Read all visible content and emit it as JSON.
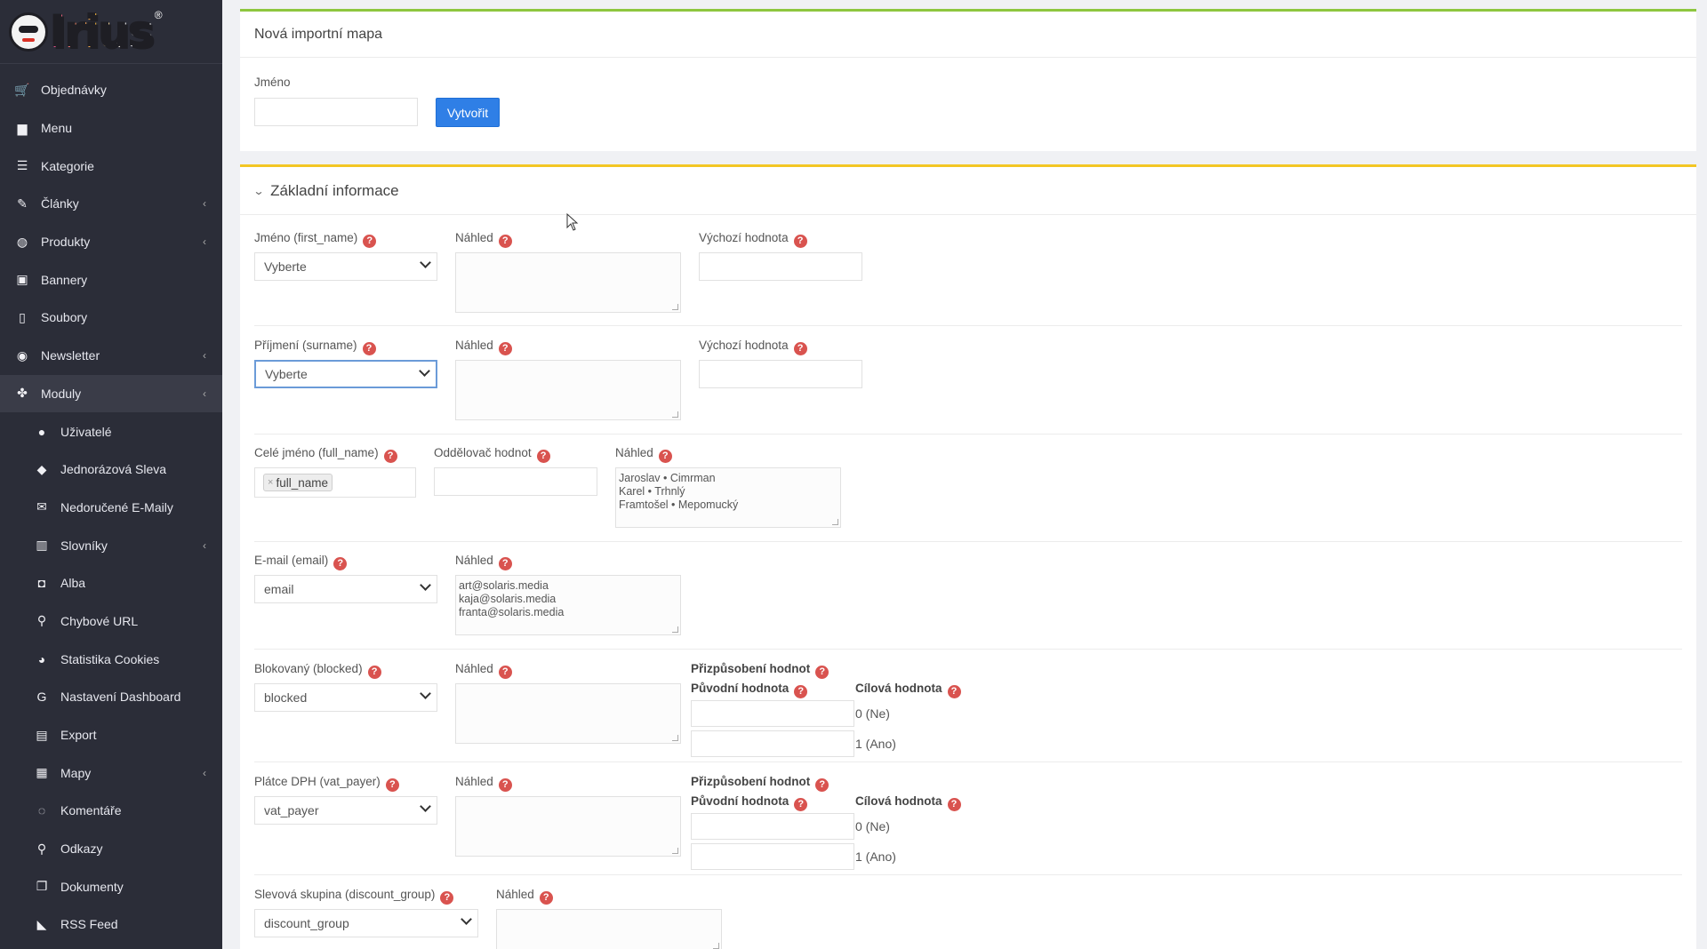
{
  "sidebar": {
    "logo_text": "Irius",
    "logo_reg": "®",
    "items": [
      {
        "label": "Objednávky",
        "icon": "cart-icon",
        "sub": false,
        "chevron": false
      },
      {
        "label": "Menu",
        "icon": "folder-icon",
        "sub": false,
        "chevron": false
      },
      {
        "label": "Kategorie",
        "icon": "list-icon",
        "sub": false,
        "chevron": false
      },
      {
        "label": "Články",
        "icon": "pencil-icon",
        "sub": false,
        "chevron": true
      },
      {
        "label": "Produkty",
        "icon": "dribbble-icon",
        "sub": false,
        "chevron": true
      },
      {
        "label": "Bannery",
        "icon": "image-icon",
        "sub": false,
        "chevron": false
      },
      {
        "label": "Soubory",
        "icon": "file-icon",
        "sub": false,
        "chevron": false
      },
      {
        "label": "Newsletter",
        "icon": "envelope-circle-icon",
        "sub": false,
        "chevron": true
      },
      {
        "label": "Moduly",
        "icon": "puzzle-icon",
        "sub": false,
        "chevron": true,
        "active": true
      },
      {
        "label": "Uživatelé",
        "icon": "user-icon",
        "sub": true,
        "chevron": false
      },
      {
        "label": "Jednorázová Sleva",
        "icon": "tags-icon",
        "sub": true,
        "chevron": false
      },
      {
        "label": "Nedoručené E-Maily",
        "icon": "envelope-icon",
        "sub": true,
        "chevron": false
      },
      {
        "label": "Slovníky",
        "icon": "books-icon",
        "sub": true,
        "chevron": true
      },
      {
        "label": "Alba",
        "icon": "camera-icon",
        "sub": true,
        "chevron": false
      },
      {
        "label": "Chybové URL",
        "icon": "link-icon",
        "sub": true,
        "chevron": false
      },
      {
        "label": "Statistika Cookies",
        "icon": "cookie-icon",
        "sub": true,
        "chevron": false
      },
      {
        "label": "Nastavení Dashboard",
        "icon": "google-icon",
        "sub": true,
        "chevron": false
      },
      {
        "label": "Export",
        "icon": "export-file-icon",
        "sub": true,
        "chevron": false
      },
      {
        "label": "Mapy",
        "icon": "map-icon",
        "sub": true,
        "chevron": true
      },
      {
        "label": "Komentáře",
        "icon": "comments-icon",
        "sub": true,
        "chevron": false
      },
      {
        "label": "Odkazy",
        "icon": "link-icon",
        "sub": true,
        "chevron": false
      },
      {
        "label": "Dokumenty",
        "icon": "copy-icon",
        "sub": true,
        "chevron": false
      },
      {
        "label": "RSS Feed",
        "icon": "rss-icon",
        "sub": true,
        "chevron": false
      }
    ]
  },
  "new_map": {
    "title": "Nová importní mapa",
    "name_label": "Jméno",
    "name_value": "",
    "create_label": "Vytvořit"
  },
  "basic": {
    "title": "Základní informace",
    "help_glyph": "?",
    "first_name": {
      "label": "Jméno (first_name)",
      "value": "Vyberte",
      "preview_label": "Náhled",
      "default_label": "Výchozí hodnota"
    },
    "surname": {
      "label": "Příjmení (surname)",
      "value": "Vyberte",
      "preview_label": "Náhled",
      "default_label": "Výchozí hodnota"
    },
    "full_name": {
      "label": "Celé jméno (full_name)",
      "tag": "full_name",
      "separator_label": "Oddělovač hodnot",
      "preview_label": "Náhled",
      "preview": "Jaroslav • Cimrman\nKarel • Trhnlý\nFramtošel • Mepomucký"
    },
    "email": {
      "label": "E-mail (email)",
      "value": "email",
      "preview_label": "Náhled",
      "preview": "art@solaris.media\nkaja@solaris.media\nfranta@solaris.media"
    },
    "blocked": {
      "label": "Blokovaný (blocked)",
      "value": "blocked",
      "preview_label": "Náhled",
      "mapping_label": "Přizpůsobení hodnot",
      "orig_label": "Původní hodnota",
      "target_label": "Cílová hodnota",
      "target_0": "0 (Ne)",
      "target_1": "1 (Ano)"
    },
    "vat_payer": {
      "label": "Plátce DPH (vat_payer)",
      "value": "vat_payer",
      "preview_label": "Náhled",
      "mapping_label": "Přizpůsobení hodnot",
      "orig_label": "Původní hodnota",
      "target_label": "Cílová hodnota",
      "target_0": "0 (Ne)",
      "target_1": "1 (Ano)"
    },
    "discount_group": {
      "label": "Slevová skupina (discount_group)",
      "value": "discount_group",
      "preview_label": "Náhled"
    }
  }
}
